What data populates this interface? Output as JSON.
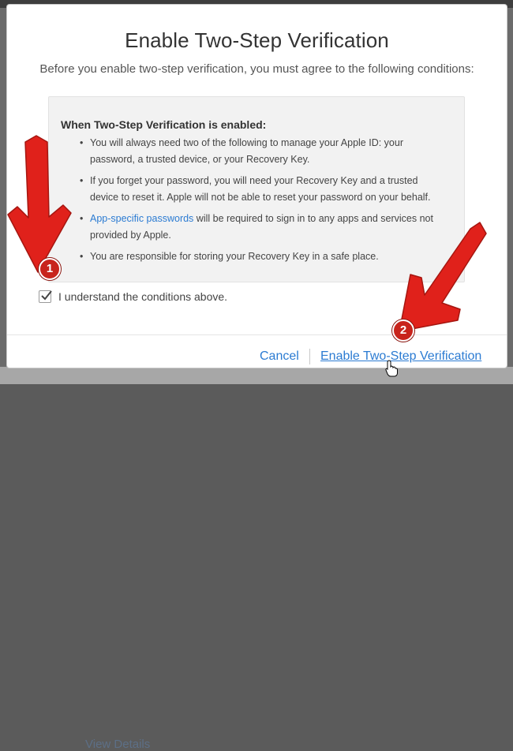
{
  "background": {
    "behind_link": "View Details"
  },
  "dialog": {
    "title": "Enable Two-Step Verification",
    "subtitle": "Before you enable two-step verification, you must agree to the following conditions:",
    "conditions": {
      "heading": "When Two-Step Verification is enabled:",
      "items": [
        {
          "text": "You will always need two of the following to manage your Apple ID: your password, a trusted device, or your Recovery Key."
        },
        {
          "text": "If you forget your password, you will need your Recovery Key and a trusted device to reset it. Apple will not be able to reset your password on your behalf."
        },
        {
          "link": "App-specific passwords",
          "text": " will be required to sign in to any apps and services not provided by Apple."
        },
        {
          "text": "You are responsible for storing your Recovery Key in a safe place."
        }
      ]
    },
    "agree_checkbox": {
      "checked": true,
      "label": "I understand the conditions above."
    },
    "footer": {
      "cancel_label": "Cancel",
      "enable_label": "Enable Two-Step Verification"
    }
  },
  "annotations": {
    "badge_1": "1",
    "badge_2": "2",
    "arrow_color": "#e0211b"
  },
  "colors": {
    "link": "#2b7bd2",
    "box_background": "#f2f2f2"
  }
}
